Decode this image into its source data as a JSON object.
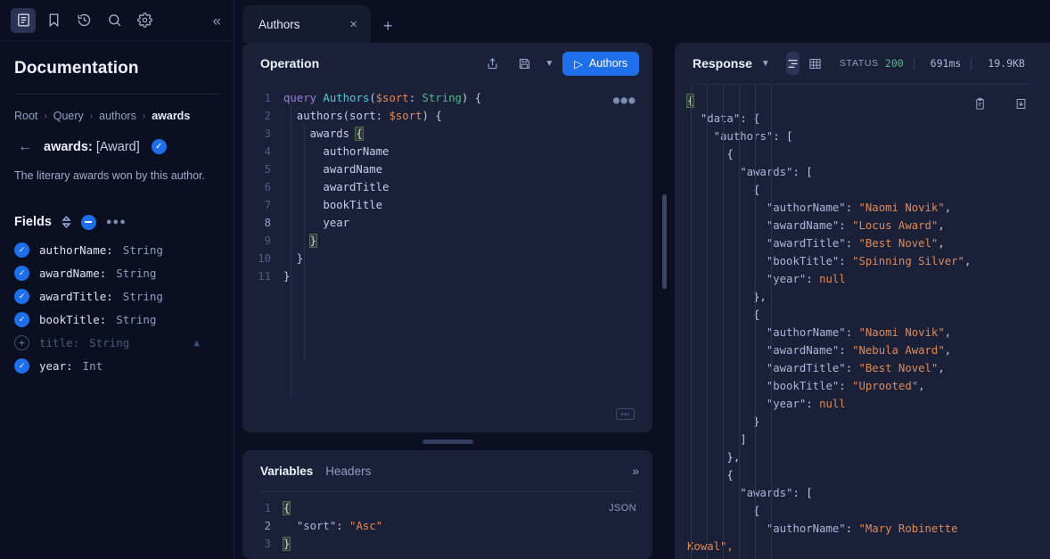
{
  "sidebar": {
    "rail": [
      {
        "name": "docs-icon",
        "label": "Documentation"
      },
      {
        "name": "bookmark-icon",
        "label": "Saved"
      },
      {
        "name": "history-icon",
        "label": "History"
      },
      {
        "name": "search-icon",
        "label": "Search"
      },
      {
        "name": "gear-icon",
        "label": "Settings"
      }
    ],
    "collapse_label": "«",
    "title": "Documentation",
    "breadcrumb": [
      "Root",
      "Query",
      "authors",
      "awards"
    ],
    "field": {
      "name": "awards:",
      "type": "[Award]",
      "description": "The literary awards won by this author."
    },
    "fields_label": "Fields",
    "fields": [
      {
        "name": "authorName:",
        "type": "String",
        "selected": true
      },
      {
        "name": "awardName:",
        "type": "String",
        "selected": true
      },
      {
        "name": "awardTitle:",
        "type": "String",
        "selected": true
      },
      {
        "name": "bookTitle:",
        "type": "String",
        "selected": true
      },
      {
        "name": "title:",
        "type": "String",
        "selected": false,
        "warning": true
      },
      {
        "name": "year:",
        "type": "Int",
        "selected": true
      }
    ]
  },
  "tabs": {
    "items": [
      {
        "label": "Authors"
      }
    ],
    "add_label": "+",
    "close_label": "×"
  },
  "operation": {
    "title": "Operation",
    "run_label": "Authors",
    "lines": [
      {
        "n": "1",
        "parts": [
          {
            "t": "query ",
            "c": "k-key"
          },
          {
            "t": "Authors",
            "c": "k-op"
          },
          {
            "t": "(",
            "c": "k-punc"
          },
          {
            "t": "$sort",
            "c": "k-arg"
          },
          {
            "t": ": ",
            "c": "k-punc"
          },
          {
            "t": "String",
            "c": "k-type"
          },
          {
            "t": ") {",
            "c": "k-punc"
          }
        ]
      },
      {
        "n": "2",
        "parts": [
          {
            "t": "  authors",
            "c": "k-fld"
          },
          {
            "t": "(",
            "c": "k-punc"
          },
          {
            "t": "sort",
            "c": "k-fld"
          },
          {
            "t": ": ",
            "c": "k-punc"
          },
          {
            "t": "$sort",
            "c": "k-arg"
          },
          {
            "t": ") {",
            "c": "k-punc"
          }
        ]
      },
      {
        "n": "3",
        "parts": [
          {
            "t": "    awards ",
            "c": "k-fld"
          },
          {
            "t": "{",
            "c": "brk-hl"
          }
        ]
      },
      {
        "n": "4",
        "parts": [
          {
            "t": "      authorName",
            "c": "k-fld"
          }
        ]
      },
      {
        "n": "5",
        "parts": [
          {
            "t": "      awardName",
            "c": "k-fld"
          }
        ]
      },
      {
        "n": "6",
        "parts": [
          {
            "t": "      awardTitle",
            "c": "k-fld"
          }
        ]
      },
      {
        "n": "7",
        "parts": [
          {
            "t": "      bookTitle",
            "c": "k-fld"
          }
        ]
      },
      {
        "n": "8",
        "parts": [
          {
            "t": "      year",
            "c": "k-fld"
          }
        ],
        "bright": true
      },
      {
        "n": "9",
        "parts": [
          {
            "t": "    ",
            "c": "k-punc"
          },
          {
            "t": "}",
            "c": "brk-hl"
          }
        ]
      },
      {
        "n": "10",
        "parts": [
          {
            "t": "  }",
            "c": "k-punc"
          }
        ]
      },
      {
        "n": "11",
        "parts": [
          {
            "t": "}",
            "c": "k-punc"
          }
        ]
      }
    ]
  },
  "variables": {
    "tabs": [
      "Variables",
      "Headers"
    ],
    "format_label": "JSON",
    "collapse_label": "»",
    "lines": [
      {
        "n": "1",
        "parts": [
          {
            "t": "{",
            "c": "brk-hl"
          }
        ]
      },
      {
        "n": "2",
        "parts": [
          {
            "t": "  ",
            "c": "k-punc"
          },
          {
            "t": "\"sort\"",
            "c": "k-prop"
          },
          {
            "t": ": ",
            "c": "k-punc"
          },
          {
            "t": "\"Asc\"",
            "c": "k-str"
          }
        ],
        "bright": true
      },
      {
        "n": "3",
        "parts": [
          {
            "t": "}",
            "c": "brk-hl"
          }
        ]
      }
    ]
  },
  "response": {
    "title": "Response",
    "status_label": "STATUS",
    "status_value": "200",
    "time": "691ms",
    "size": "19.9KB",
    "lines": [
      [
        {
          "t": "{",
          "c": "brk-hl"
        }
      ],
      [
        {
          "t": "  ",
          "c": "k-punc"
        },
        {
          "t": "\"data\"",
          "c": "k-prop"
        },
        {
          "t": ": {",
          "c": "k-punc"
        }
      ],
      [
        {
          "t": "    ",
          "c": "k-punc"
        },
        {
          "t": "\"authors\"",
          "c": "k-prop"
        },
        {
          "t": ": [",
          "c": "k-punc"
        }
      ],
      [
        {
          "t": "      {",
          "c": "k-punc"
        }
      ],
      [
        {
          "t": "        ",
          "c": "k-punc"
        },
        {
          "t": "\"awards\"",
          "c": "k-prop"
        },
        {
          "t": ": [",
          "c": "k-punc"
        }
      ],
      [
        {
          "t": "          {",
          "c": "k-punc"
        }
      ],
      [
        {
          "t": "            ",
          "c": "k-punc"
        },
        {
          "t": "\"authorName\"",
          "c": "k-prop"
        },
        {
          "t": ": ",
          "c": "k-punc"
        },
        {
          "t": "\"Naomi Novik\"",
          "c": "k-str"
        },
        {
          "t": ",",
          "c": "k-punc"
        }
      ],
      [
        {
          "t": "            ",
          "c": "k-punc"
        },
        {
          "t": "\"awardName\"",
          "c": "k-prop"
        },
        {
          "t": ": ",
          "c": "k-punc"
        },
        {
          "t": "\"Locus Award\"",
          "c": "k-str"
        },
        {
          "t": ",",
          "c": "k-punc"
        }
      ],
      [
        {
          "t": "            ",
          "c": "k-punc"
        },
        {
          "t": "\"awardTitle\"",
          "c": "k-prop"
        },
        {
          "t": ": ",
          "c": "k-punc"
        },
        {
          "t": "\"Best Novel\"",
          "c": "k-str"
        },
        {
          "t": ",",
          "c": "k-punc"
        }
      ],
      [
        {
          "t": "            ",
          "c": "k-punc"
        },
        {
          "t": "\"bookTitle\"",
          "c": "k-prop"
        },
        {
          "t": ": ",
          "c": "k-punc"
        },
        {
          "t": "\"Spinning Silver\"",
          "c": "k-str"
        },
        {
          "t": ",",
          "c": "k-punc"
        }
      ],
      [
        {
          "t": "            ",
          "c": "k-punc"
        },
        {
          "t": "\"year\"",
          "c": "k-prop"
        },
        {
          "t": ": ",
          "c": "k-punc"
        },
        {
          "t": "null",
          "c": "k-null"
        }
      ],
      [
        {
          "t": "          },",
          "c": "k-punc"
        }
      ],
      [
        {
          "t": "          {",
          "c": "k-punc"
        }
      ],
      [
        {
          "t": "            ",
          "c": "k-punc"
        },
        {
          "t": "\"authorName\"",
          "c": "k-prop"
        },
        {
          "t": ": ",
          "c": "k-punc"
        },
        {
          "t": "\"Naomi Novik\"",
          "c": "k-str"
        },
        {
          "t": ",",
          "c": "k-punc"
        }
      ],
      [
        {
          "t": "            ",
          "c": "k-punc"
        },
        {
          "t": "\"awardName\"",
          "c": "k-prop"
        },
        {
          "t": ": ",
          "c": "k-punc"
        },
        {
          "t": "\"Nebula Award\"",
          "c": "k-str"
        },
        {
          "t": ",",
          "c": "k-punc"
        }
      ],
      [
        {
          "t": "            ",
          "c": "k-punc"
        },
        {
          "t": "\"awardTitle\"",
          "c": "k-prop"
        },
        {
          "t": ": ",
          "c": "k-punc"
        },
        {
          "t": "\"Best Novel\"",
          "c": "k-str"
        },
        {
          "t": ",",
          "c": "k-punc"
        }
      ],
      [
        {
          "t": "            ",
          "c": "k-punc"
        },
        {
          "t": "\"bookTitle\"",
          "c": "k-prop"
        },
        {
          "t": ": ",
          "c": "k-punc"
        },
        {
          "t": "\"Uprooted\"",
          "c": "k-str"
        },
        {
          "t": ",",
          "c": "k-punc"
        }
      ],
      [
        {
          "t": "            ",
          "c": "k-punc"
        },
        {
          "t": "\"year\"",
          "c": "k-prop"
        },
        {
          "t": ": ",
          "c": "k-punc"
        },
        {
          "t": "null",
          "c": "k-null"
        }
      ],
      [
        {
          "t": "          }",
          "c": "k-punc"
        }
      ],
      [
        {
          "t": "        ]",
          "c": "k-punc"
        }
      ],
      [
        {
          "t": "      },",
          "c": "k-punc"
        }
      ],
      [
        {
          "t": "      {",
          "c": "k-punc"
        }
      ],
      [
        {
          "t": "        ",
          "c": "k-punc"
        },
        {
          "t": "\"awards\"",
          "c": "k-prop"
        },
        {
          "t": ": [",
          "c": "k-punc"
        }
      ],
      [
        {
          "t": "          {",
          "c": "k-punc"
        }
      ],
      [
        {
          "t": "            ",
          "c": "k-punc"
        },
        {
          "t": "\"authorName\"",
          "c": "k-prop"
        },
        {
          "t": ": ",
          "c": "k-punc"
        },
        {
          "t": "\"Mary Robinette",
          "c": "k-str"
        }
      ],
      [
        {
          "t": "Kowal\",",
          "c": "k-str"
        }
      ]
    ]
  },
  "colors": {
    "accent": "#1f6feb",
    "panel_bg": "#1b2039",
    "app_bg": "#0a1022",
    "status_ok": "#57b894"
  }
}
